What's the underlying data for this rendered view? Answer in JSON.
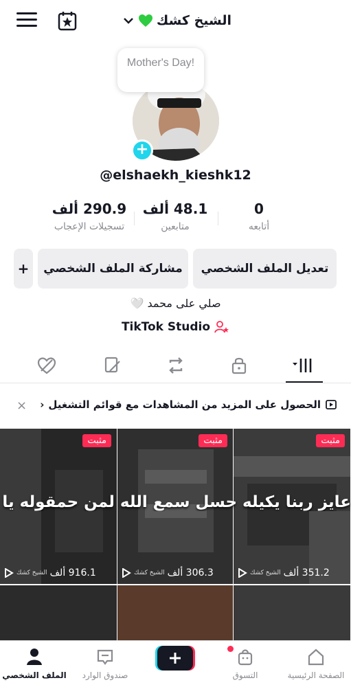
{
  "header": {
    "title": "الشيخ كشك",
    "note": "Mother's Day!",
    "username": "@elshaekh_kieshk12"
  },
  "stats": {
    "likes": {
      "value": "290.9 ألف",
      "label": "تسجيلات الإعجاب"
    },
    "followers": {
      "value": "48.1 ألف",
      "label": "متابعين"
    },
    "following": {
      "value": "0",
      "label": "أتابعه"
    }
  },
  "buttons": {
    "edit_profile": "تعديل الملف الشخصي",
    "share_profile": "مشاركة الملف الشخصي",
    "add": "+"
  },
  "bio": "صلي على محمد 🤍",
  "studio": "TikTok Studio",
  "banner": {
    "text": "الحصول على المزيد من المشاهدات مع قوائم التشغيل",
    "arrow": "‹",
    "close": "×"
  },
  "videos": [
    {
      "pinned": "مثبت",
      "views": "916.1 ألف",
      "watermark": "الشيخ كشك"
    },
    {
      "pinned": "مثبت",
      "views": "306.3 ألف",
      "watermark": "الشيخ كشك"
    },
    {
      "pinned": "مثبت",
      "views": "351.2 ألف",
      "watermark": "الشيخ كشك"
    }
  ],
  "video_overlay_text": "عايز ربنا يكيله حسل سمع الله لمن حمقوله يا رب بلغني",
  "nav": {
    "home": "الصفحة الرئيسية",
    "shop": "التسوق",
    "inbox": "صندوق الوارد",
    "profile": "الملف الشخصي"
  },
  "colors": {
    "accent_red": "#fe2c55",
    "accent_cyan": "#20d5ec",
    "text_primary": "#161823",
    "text_secondary": "#8a8b91"
  }
}
